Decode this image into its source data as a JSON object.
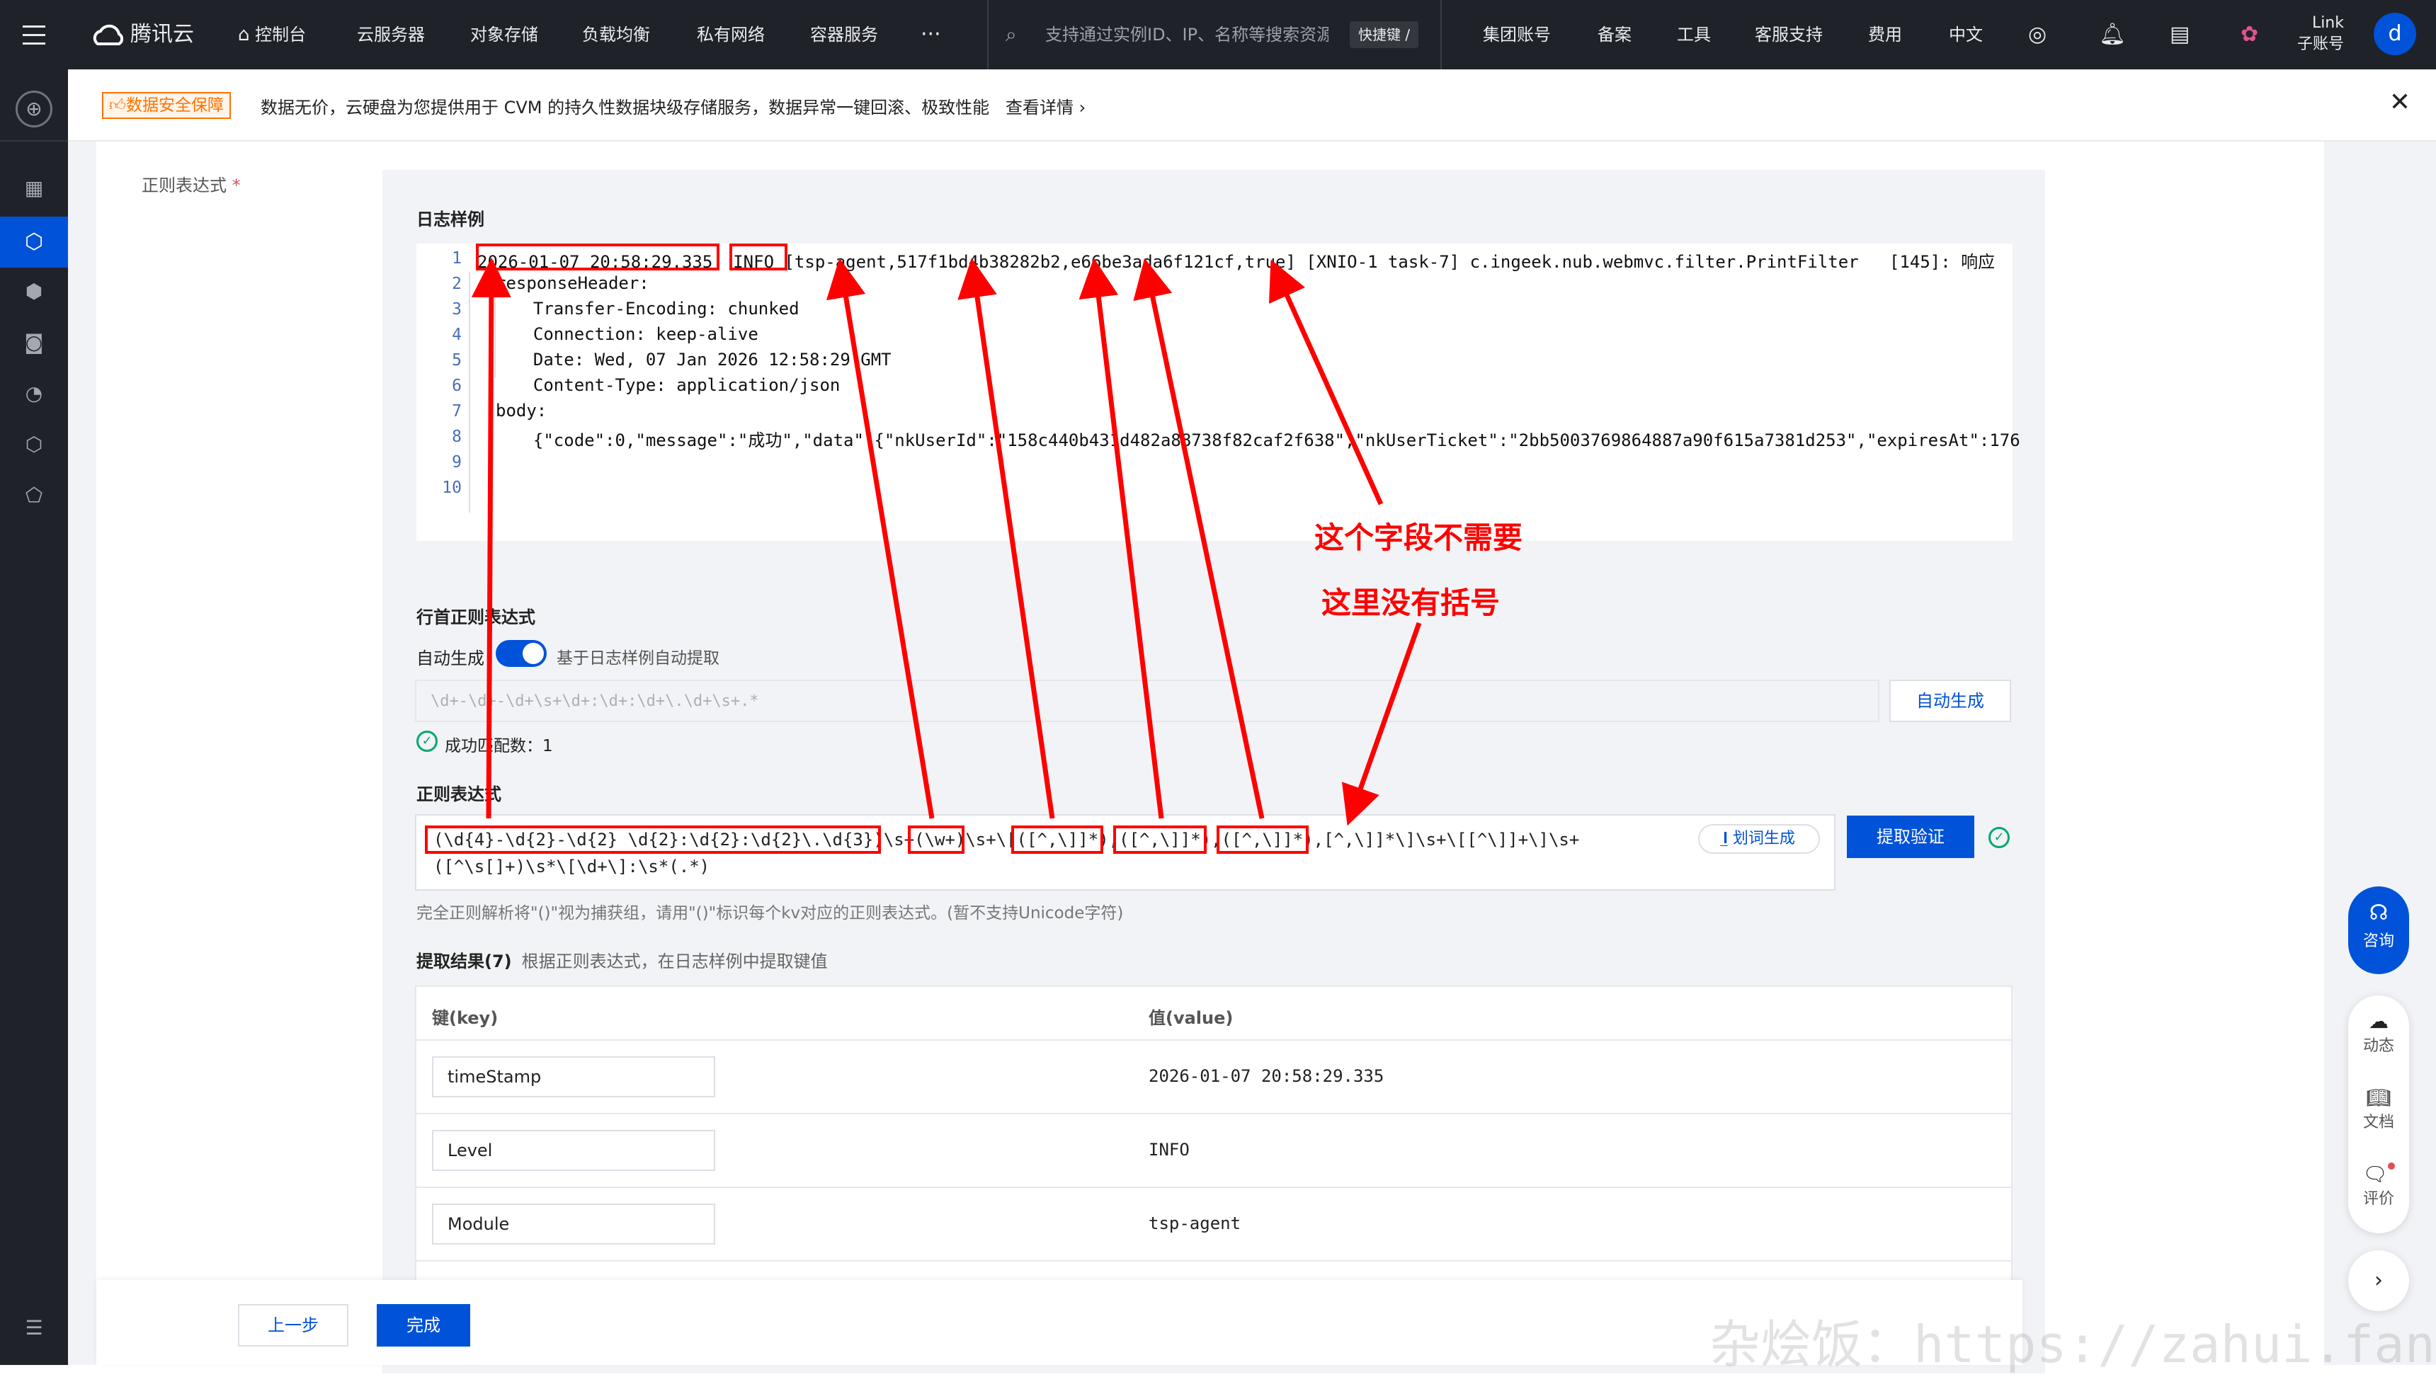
{
  "topbar": {
    "logo": "腾讯云",
    "nav": [
      "控制台",
      "云服务器",
      "对象存储",
      "负载均衡",
      "私有网络",
      "容器服务",
      "···"
    ],
    "search_placeholder": "支持通过实例ID、IP、名称等搜索资源",
    "shortcut": "快捷键 /",
    "right_links": [
      "集团账号",
      "备案",
      "工具",
      "客服支持",
      "费用",
      "中文"
    ],
    "user_line1": "Link",
    "user_line2": "子账号",
    "avatar": "d"
  },
  "notice": {
    "badge": "数据安全保障",
    "text": "数据无价，云硬盘为您提供用于 CVM 的持久性数据块级存储服务，数据异常一键回滚、极致性能",
    "link": "查看详情 ›"
  },
  "form": {
    "field_label": "正则表达式",
    "sample_title": "日志样例",
    "sample_lines": [
      "2026-01-07 20:58:29.335  INFO [tsp-agent,517f1bd4b38282b2,e66be3ada6f121cf,true] [XNIO-1 task-7] c.ingeek.nub.webmvc.filter.PrintFilter   [145]: 响应",
      "responseHeader:",
      "  Transfer-Encoding: chunked",
      "  Connection: keep-alive",
      "  Date: Wed, 07 Jan 2026 12:58:29 GMT",
      "  Content-Type: application/json",
      "body:",
      "  {\"code\":0,\"message\":\"成功\",\"data\":{\"nkUserId\":\"158c440b431d482a88738f82caf2f638\",\"nkUserTicket\":\"2bb5003769864887a90f615a7381d253\",\"expiresAt\":176",
      "",
      ""
    ],
    "line_numbers": [
      "1",
      "2",
      "3",
      "4",
      "5",
      "6",
      "7",
      "8",
      "9",
      "10"
    ],
    "first_line_title": "行首正则表达式",
    "auto_label": "自动生成",
    "auto_hint": "基于日志样例自动提取",
    "first_line_value": "\\d+-\\d+-\\d+\\s+\\d+:\\d+:\\d+\\.\\d+\\s+.*",
    "auto_button": "自动生成",
    "match_text": "成功匹配数：1",
    "regex_title": "正则表达式",
    "regex_line1": "(\\d{4}-\\d{2}-\\d{2} \\d{2}:\\d{2}:\\d{2}\\.\\d{3})\\s+(\\w+)\\s+\\[([^,\\]]*),([^,\\]]*),([^,\\]]*),[^,\\]]*\\]\\s+\\[[^\\]]+\\]\\s+",
    "regex_line2": "([^\\s[]+)\\s*\\[\\d+\\]:\\s*(.*)",
    "word_gen": "划词生成",
    "extract_button": "提取验证",
    "regex_hint": "完全正则解析将\"()\"视为捕获组，请用\"()\"标识每个kv对应的正则表达式。(暂不支持Unicode字符)",
    "result_title": "提取结果(7)",
    "result_hint": "根据正则表达式，在日志样例中提取键值",
    "col_key": "键(key)",
    "col_value": "值(value)",
    "rows": [
      {
        "key": "timeStamp",
        "value": "2026-01-07 20:58:29.335"
      },
      {
        "key": "Level",
        "value": "INFO"
      },
      {
        "key": "Module",
        "value": "tsp-agent"
      }
    ]
  },
  "footer": {
    "prev": "上一步",
    "finish": "完成"
  },
  "rightbar": {
    "consult": "咨询",
    "dynamic": "动态",
    "docs": "文档",
    "review": "评价"
  },
  "annotations": {
    "a1": "这个字段不需要",
    "a2": "这里没有括号"
  },
  "watermark": "杂烩饭：https://zahui.fan",
  "colors": {
    "primary": "#0052d9",
    "annotation": "#ff0000",
    "topbar": "#1f2228"
  }
}
